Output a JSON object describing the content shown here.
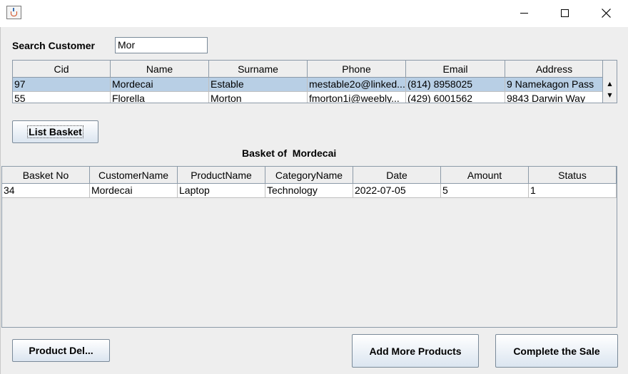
{
  "window": {
    "icon": "java-cup-icon",
    "controls": {
      "minimize": "minimize-icon",
      "maximize": "maximize-icon",
      "close": "close-icon"
    }
  },
  "search": {
    "label": "Search Customer",
    "value": "Mor"
  },
  "customers": {
    "columns": [
      "Cid",
      "Name",
      "Surname",
      "Phone",
      "Email",
      "Address"
    ],
    "rows": [
      [
        "97",
        "Mordecai",
        "Estable",
        "mestable2o@linked...",
        "(814) 8958025",
        "9 Namekagon Pass"
      ],
      [
        "55",
        "Florella",
        "Morton",
        "fmorton1i@weebly...",
        "(429) 6001562",
        "9843 Darwin Way"
      ]
    ],
    "selected_row": 0
  },
  "list_basket_button": "List Basket",
  "basket_title": "Basket of  Mordecai",
  "basket": {
    "columns": [
      "Basket No",
      "CustomerName",
      "ProductName",
      "CategoryName",
      "Date",
      "Amount",
      "Status"
    ],
    "rows": [
      [
        "34",
        "Mordecai",
        "Laptop",
        "Technology",
        "2022-07-05",
        "5",
        "1"
      ]
    ]
  },
  "buttons": {
    "product_del": "Product Del...",
    "add_more": "Add More Products",
    "complete": "Complete the Sale"
  }
}
